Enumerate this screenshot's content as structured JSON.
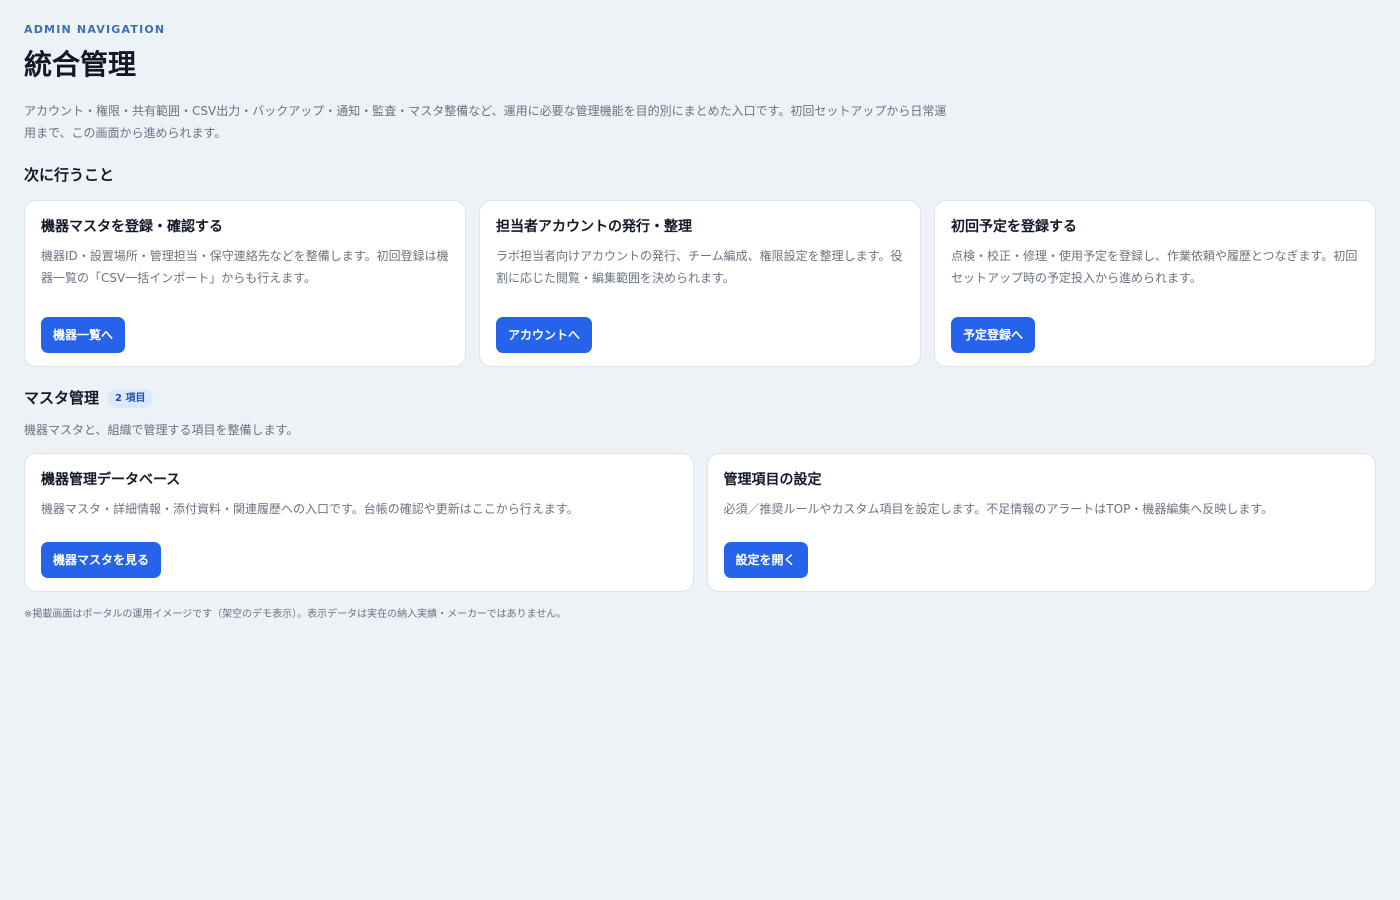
{
  "header": {
    "eyebrow": "ADMIN NAVIGATION",
    "title": "統合管理",
    "intro": "アカウント・権限・共有範囲・CSV出力・バックアップ・通知・監査・マスタ整備など、運用に必要な管理機能を目的別にまとめた入口です。初回セットアップから日常運用まで、この画面から進められます。"
  },
  "next_steps": {
    "title": "次に行うこと",
    "cards": [
      {
        "title": "機器マスタを登録・確認する",
        "desc": "機器ID・設置場所・管理担当・保守連絡先などを整備します。初回登録は機器一覧の「CSV一括インポート」からも行えます。",
        "button": "機器一覧へ"
      },
      {
        "title": "担当者アカウントの発行・整理",
        "desc": "ラボ担当者向けアカウントの発行、チーム編成、権限設定を整理します。役割に応じた閲覧・編集範囲を決められます。",
        "button": "アカウントへ"
      },
      {
        "title": "初回予定を登録する",
        "desc": "点検・校正・修理・使用予定を登録し、作業依頼や履歴とつなぎます。初回セットアップ時の予定投入から進められます。",
        "button": "予定登録へ"
      }
    ]
  },
  "master": {
    "title": "マスタ管理",
    "badge": "2 項目",
    "desc": "機器マスタと、組織で管理する項目を整備します。",
    "cards": [
      {
        "title": "機器管理データベース",
        "desc": "機器マスタ・詳細情報・添付資料・関連履歴への入口です。台帳の確認や更新はここから行えます。",
        "button": "機器マスタを見る"
      },
      {
        "title": "管理項目の設定",
        "desc": "必須／推奨ルールやカスタム項目を設定します。不足情報のアラートはTOP・機器編集へ反映します。",
        "button": "設定を開く"
      }
    ]
  },
  "footnote": "※掲載画面はポータルの運用イメージです（架空のデモ表示）。表示データは実在の納入実績・メーカーではありません。"
}
